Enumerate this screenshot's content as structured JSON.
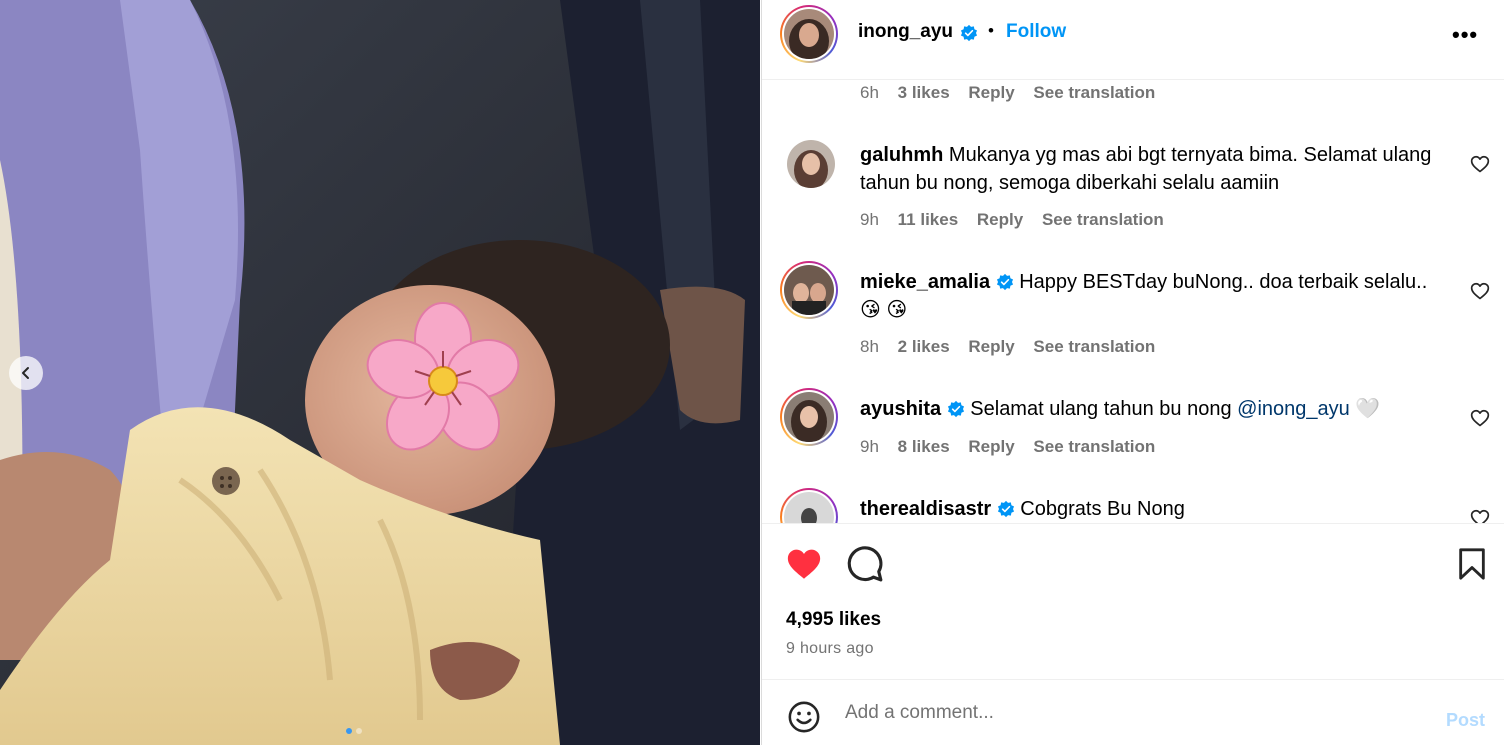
{
  "post": {
    "image_alt": "Baby in knit sweater with flower emoji sticker",
    "nav_prev": "‹"
  },
  "header": {
    "username": "inong_ayu",
    "separator": "•",
    "follow_label": "Follow",
    "more_label": "•••"
  },
  "comments": [
    {
      "username": "",
      "text": "",
      "time": "6h",
      "likes": "3 likes",
      "reply": "Reply",
      "translate": "See translation"
    },
    {
      "username": "galuhmh",
      "text": "Mukanya yg mas abi bgt ternyata bima. Selamat ulang tahun bu nong, semoga diberkahi selalu aamiin",
      "time": "9h",
      "likes": "11 likes",
      "reply": "Reply",
      "translate": "See translation"
    },
    {
      "username": "mieke_amalia",
      "text": "Happy BESTday buNong.. doa terbaik selalu.. 😘 😘",
      "time": "8h",
      "likes": "2 likes",
      "reply": "Reply",
      "translate": "See translation"
    },
    {
      "username": "ayushita",
      "text": "Selamat ulang tahun bu nong ",
      "mention": "@inong_ayu",
      "emoji": "🤍",
      "time": "9h",
      "likes": "8 likes",
      "reply": "Reply",
      "translate": "See translation"
    },
    {
      "username": "therealdisastr",
      "text": "Cobgrats Bu Nong"
    }
  ],
  "actions": {
    "likes": "4,995 likes",
    "time_ago": "9 hours ago",
    "liked": true
  },
  "add_comment": {
    "placeholder": "Add a comment...",
    "post_label": "Post"
  },
  "colors": {
    "accent": "#0095f6",
    "like_red": "#ff3040",
    "verified": "#0095f6",
    "post_disabled": "#b3dbff",
    "meta_gray": "#737373"
  }
}
